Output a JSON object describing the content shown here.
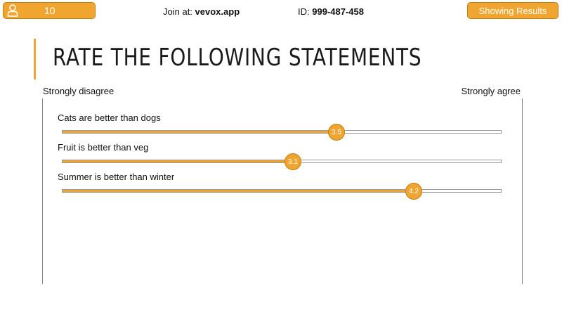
{
  "header": {
    "participant_count": "10",
    "join_label": "Join at:",
    "join_url": "vevox.app",
    "id_label": "ID:",
    "id_value": "999-487-458",
    "status_button": "Showing Results"
  },
  "question": {
    "title": "RATE THE FOLLOWING STATEMENTS",
    "scale_min_label": "Strongly disagree",
    "scale_max_label": "Strongly agree",
    "scale_min": 1,
    "scale_max": 5
  },
  "statements": [
    {
      "label": "Cats are better than dogs",
      "average": "3.5"
    },
    {
      "label": "Fruit is better than veg",
      "average": "3.1"
    },
    {
      "label": "Summer is better than winter",
      "average": "4.2"
    }
  ],
  "colors": {
    "accent": "#F0A530",
    "accent_border": "#c17f12"
  },
  "icons": {
    "participants": "person-icon"
  }
}
